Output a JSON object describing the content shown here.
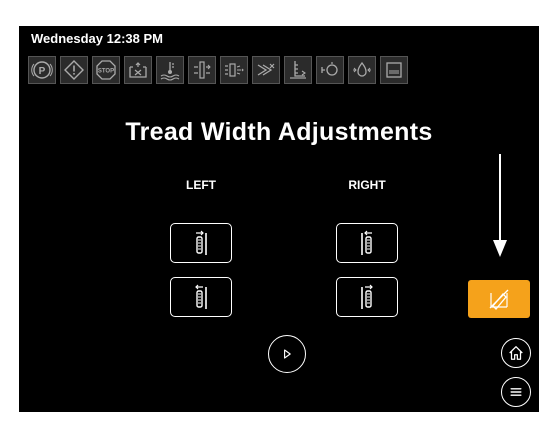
{
  "status_bar": {
    "datetime": "Wednesday 12:38 PM",
    "icons": [
      "parking-brake-icon",
      "warning-icon",
      "stop-icon",
      "fuel-filter-icon",
      "coolant-temperature-icon",
      "tread-lock-icon",
      "spray-icon",
      "boom-fold-icon",
      "hydraulic-level-icon",
      "engine-oil-icon",
      "oil-pressure-icon",
      "tank-level-icon"
    ]
  },
  "main": {
    "title": "Tread Width Adjustments",
    "left_label": "LEFT",
    "right_label": "RIGHT"
  },
  "icons": {
    "play": "play-icon",
    "orange_button": "tread-adjust-off-icon",
    "home": "home-icon",
    "menu": "menu-icon"
  },
  "colors": {
    "screen_background": "#000000",
    "accent_orange": "#f5a21b",
    "status_icon_background": "#2b2b2b"
  }
}
